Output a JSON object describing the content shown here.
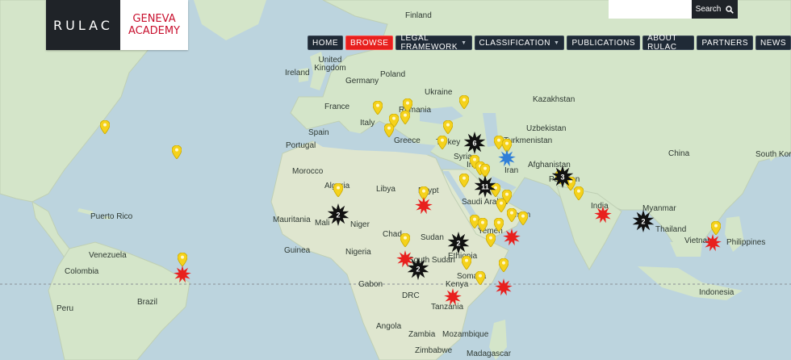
{
  "brand": {
    "left_text": "RULAC",
    "right_line1": "GENEVA",
    "right_line2": "ACADEMY",
    "right_color": "#c8102e"
  },
  "search": {
    "placeholder": "",
    "button_label": "Search",
    "icon": "search-icon"
  },
  "nav": {
    "items": [
      {
        "label": "HOME",
        "dropdown": false,
        "active": false
      },
      {
        "label": "BROWSE",
        "dropdown": false,
        "active": true
      },
      {
        "label": "LEGAL FRAMEWORK",
        "dropdown": true,
        "active": false
      },
      {
        "label": "CLASSIFICATION",
        "dropdown": true,
        "active": false
      },
      {
        "label": "PUBLICATIONS",
        "dropdown": false,
        "active": false
      },
      {
        "label": "ABOUT RULAC",
        "dropdown": false,
        "active": false
      },
      {
        "label": "PARTNERS",
        "dropdown": false,
        "active": false
      },
      {
        "label": "NEWS",
        "dropdown": false,
        "active": false
      }
    ]
  },
  "map": {
    "labels": {
      "finland": "Finland",
      "uk": "United Kingdom",
      "ireland": "Ireland",
      "germany": "Germany",
      "poland": "Poland",
      "ukraine": "Ukraine",
      "france": "France",
      "romania": "Romania",
      "italy": "Italy",
      "spain": "Spain",
      "portugal": "Portugal",
      "greece": "Greece",
      "turkey": "Turkey",
      "syria": "Syria",
      "iraq": "Iraq",
      "iran": "Iran",
      "kazakhstan": "Kazakhstan",
      "uzbekistan": "Uzbekistan",
      "turkmenistan": "Turkmenistan",
      "afghanistan": "Afghanistan",
      "pakistan": "Pakistan",
      "china": "China",
      "south_korea": "South Korea",
      "india": "India",
      "myanmar": "Myanmar",
      "thailand": "Thailand",
      "vietnam": "Vietnam",
      "philippines": "Philippines",
      "indonesia": "Indonesia",
      "morocco": "Morocco",
      "algeria": "Algeria",
      "libya": "Libya",
      "egypt": "Egypt",
      "saudi_arabia": "Saudi Arabia",
      "oman": "Oman",
      "yemen": "Yemen",
      "mauritania": "Mauritania",
      "mali": "Mali",
      "niger": "Niger",
      "chad": "Chad",
      "sudan": "Sudan",
      "south_sudan": "South Sudan",
      "ethiopia": "Ethiopia",
      "somalia": "Somalia",
      "nigeria": "Nigeria",
      "drc": "DRC",
      "kenya": "Kenya",
      "tanzania": "Tanzania",
      "angola": "Angola",
      "zambia": "Zambia",
      "mozambique": "Mozambique",
      "zimbabwe": "Zimbabwe",
      "madagascar": "Madagascar",
      "guinea": "Guinea",
      "gabon": "Gabon",
      "puerto_rico": "Puerto Rico",
      "venezuela": "Venezuela",
      "colombia": "Colombia",
      "brazil": "Brazil",
      "peru": "Peru"
    },
    "pins": [
      {
        "type": "yellow",
        "lon": -104,
        "lat": 48
      },
      {
        "type": "yellow",
        "lon": -77,
        "lat": 40
      },
      {
        "type": "yellow",
        "lon": -17,
        "lat": 28
      },
      {
        "type": "yellow",
        "lon": -2,
        "lat": 54
      },
      {
        "type": "yellow",
        "lon": 4,
        "lat": 50
      },
      {
        "type": "yellow",
        "lon": 2,
        "lat": 47
      },
      {
        "type": "yellow",
        "lon": 9,
        "lat": 55
      },
      {
        "type": "yellow",
        "lon": 8,
        "lat": 51
      },
      {
        "type": "yellow",
        "lon": 30,
        "lat": 56
      },
      {
        "type": "yellow",
        "lon": 24,
        "lat": 48
      },
      {
        "type": "yellow",
        "lon": 22,
        "lat": 43
      },
      {
        "type": "yellow",
        "lon": 43,
        "lat": 43
      },
      {
        "type": "yellow",
        "lon": 46,
        "lat": 42
      },
      {
        "type": "yellow",
        "lon": 34,
        "lat": 37
      },
      {
        "type": "yellow",
        "lon": 36,
        "lat": 35
      },
      {
        "type": "yellow",
        "lon": 38,
        "lat": 34
      },
      {
        "type": "yellow",
        "lon": 30,
        "lat": 31
      },
      {
        "type": "yellow",
        "lon": 42,
        "lat": 28
      },
      {
        "type": "yellow",
        "lon": 46,
        "lat": 26
      },
      {
        "type": "yellow",
        "lon": 44,
        "lat": 23
      },
      {
        "type": "yellow",
        "lon": 48,
        "lat": 20
      },
      {
        "type": "yellow",
        "lon": 52,
        "lat": 19
      },
      {
        "type": "yellow",
        "lon": 15,
        "lat": 27
      },
      {
        "type": "yellow",
        "lon": 34,
        "lat": 18
      },
      {
        "type": "yellow",
        "lon": 37,
        "lat": 17
      },
      {
        "type": "yellow",
        "lon": 43,
        "lat": 17
      },
      {
        "type": "yellow",
        "lon": 40,
        "lat": 12
      },
      {
        "type": "yellow",
        "lon": 45,
        "lat": 4
      },
      {
        "type": "yellow",
        "lon": 36,
        "lat": 0
      },
      {
        "type": "yellow",
        "lon": 31,
        "lat": 5
      },
      {
        "type": "yellow",
        "lon": 8,
        "lat": 12
      },
      {
        "type": "yellow",
        "lon": -75,
        "lat": 6
      },
      {
        "type": "yellow",
        "lon": 66,
        "lat": 32
      },
      {
        "type": "yellow",
        "lon": 70,
        "lat": 30
      },
      {
        "type": "yellow",
        "lon": 73,
        "lat": 27
      },
      {
        "type": "yellow",
        "lon": 124,
        "lat": 16
      },
      {
        "type": "red",
        "lon": 15,
        "lat": 25
      },
      {
        "type": "red",
        "lon": 8,
        "lat": 8
      },
      {
        "type": "red",
        "lon": -75,
        "lat": 3
      },
      {
        "type": "red",
        "lon": 48,
        "lat": 15
      },
      {
        "type": "red",
        "lon": 45,
        "lat": -1
      },
      {
        "type": "red",
        "lon": 26,
        "lat": -4
      },
      {
        "type": "red",
        "lon": 82,
        "lat": 22
      },
      {
        "type": "red",
        "lon": 123,
        "lat": 13
      },
      {
        "type": "blue",
        "lon": 46,
        "lat": 40
      },
      {
        "type": "black",
        "lon": 34,
        "lat": 45,
        "count": "6"
      },
      {
        "type": "black",
        "lon": 38,
        "lat": 31,
        "count": "11"
      },
      {
        "type": "black",
        "lon": -17,
        "lat": 22,
        "count": "2"
      },
      {
        "type": "black",
        "lon": 28,
        "lat": 13,
        "count": "2"
      },
      {
        "type": "black",
        "lon": 13,
        "lat": 5,
        "count": "2"
      },
      {
        "type": "black",
        "lon": 67,
        "lat": 34,
        "count": "3"
      },
      {
        "type": "black",
        "lon": 97,
        "lat": 20,
        "count": "2"
      }
    ]
  },
  "colors": {
    "nav_bg": "#1f2a36",
    "nav_active": "#e8201e",
    "pin_yellow": "#f5d21b",
    "pin_red": "#e8201e",
    "pin_black": "#111111",
    "pin_blue": "#2f7fd8",
    "water": "#b9d3dd",
    "land": "#d3e4c8"
  }
}
